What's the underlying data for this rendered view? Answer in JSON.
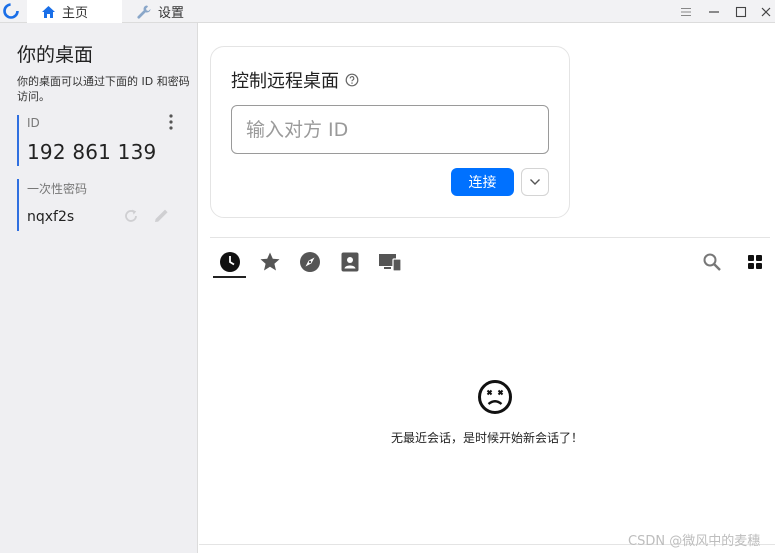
{
  "titlebar": {
    "tabs": [
      {
        "label": "主页",
        "icon": "home-icon"
      },
      {
        "label": "设置",
        "icon": "wrench-icon"
      }
    ],
    "window_controls": [
      "menu-icon",
      "minimize-icon",
      "maximize-icon",
      "close-icon"
    ]
  },
  "left_panel": {
    "title": "你的桌面",
    "description": "你的桌面可以通过下面的 ID 和密码访问。",
    "id_label": "ID",
    "id_value": "192 861 139",
    "password_label": "一次性密码",
    "password_value": "nqxf2s"
  },
  "connect_card": {
    "title": "控制远程桌面",
    "input_placeholder": "输入对方 ID",
    "connect_label": "连接"
  },
  "session_tabs": [
    "recent-sessions",
    "favorites",
    "discovered",
    "address-book",
    "accessible-devices"
  ],
  "empty_state": {
    "message": "无最近会话，是时候开始新会话了！"
  },
  "watermark": "CSDN @微风中的麦穗",
  "colors": {
    "accent": "#0071ff",
    "left_bar": "#2f6fe0",
    "sidebar_bg": "#efeff2"
  }
}
